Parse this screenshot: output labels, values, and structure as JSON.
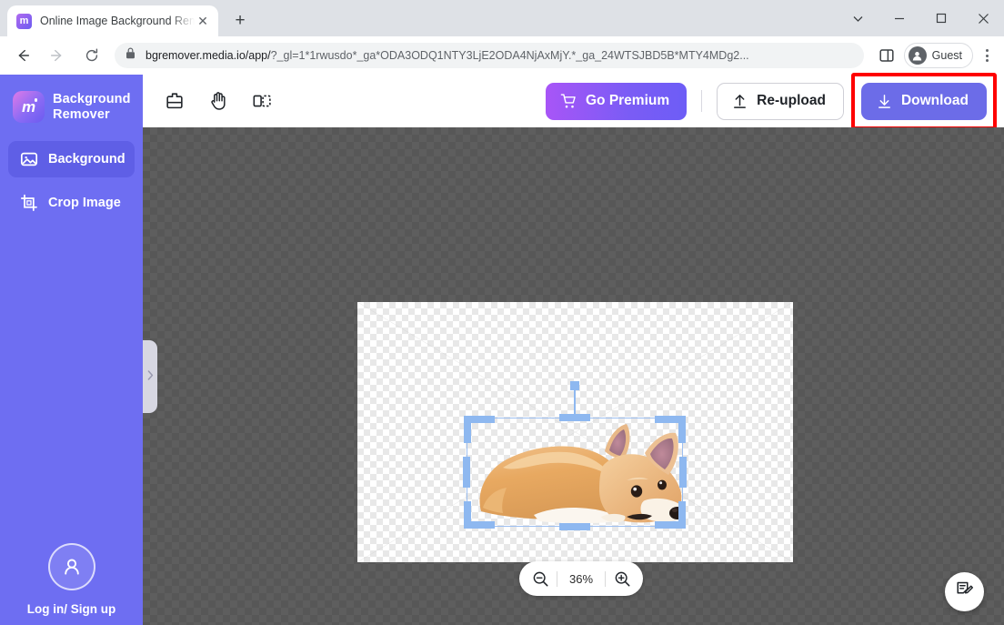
{
  "browser": {
    "tab": {
      "title": "Online Image Background Rem",
      "favicon_letter": "m",
      "favicon_name": "media-io-favicon",
      "close_label": "✕"
    },
    "new_tab_label": "+",
    "window_controls": {
      "chevron": "chevron-down",
      "minimize": "minimize",
      "maximize": "maximize",
      "close": "close"
    },
    "nav": {
      "back": "back-arrow",
      "forward": "forward-arrow",
      "reload": "reload"
    },
    "omnibox": {
      "lock": "lock-icon",
      "url_main": "bgremover.media.io/app/",
      "url_query": "?_gl=1*1rwusdo*_ga*ODA3ODQ1NTY3LjE2ODA4NjAxMjY.*_ga_24WTSJBD5B*MTY4MDg2..."
    },
    "profile": {
      "label": "Guest",
      "avatar_icon": "person-icon"
    },
    "side_panel_icon": "side-panel-icon",
    "menu_icon": "three-dot-menu"
  },
  "sidebar": {
    "brand": {
      "logo_letter": "m",
      "name_line1": "Background",
      "name_line2": "Remover"
    },
    "items": [
      {
        "label": "Background",
        "icon": "image-icon",
        "active": true
      },
      {
        "label": "Crop Image",
        "icon": "crop-icon",
        "active": false
      }
    ],
    "login": {
      "label": "Log in/ Sign up",
      "icon": "user-avatar-icon"
    }
  },
  "toolbar": {
    "tools": [
      {
        "name": "eraser-tool",
        "title": "Erase"
      },
      {
        "name": "hand-tool",
        "title": "Pan"
      },
      {
        "name": "compare-tool",
        "title": "Compare"
      }
    ],
    "premium_label": "Go Premium",
    "premium_icon": "cart-icon",
    "reupload_label": "Re-upload",
    "reupload_icon": "upload-icon",
    "download_label": "Download",
    "download_icon": "download-icon"
  },
  "canvas": {
    "panel_handle_icon": "chevron-right-icon",
    "image_subject": "corgi-dog-cutout",
    "selection_active": true
  },
  "zoom": {
    "out_icon": "zoom-out-icon",
    "in_icon": "zoom-in-icon",
    "value": "36%"
  },
  "feedback": {
    "icon": "feedback-note-icon"
  },
  "annotations": {
    "highlight_target": "Download",
    "highlight_color": "#ff0000",
    "arrow_color": "#ff0000"
  },
  "colors": {
    "sidebar_bg": "#6e6ef2",
    "sidebar_active": "#5f5fe6",
    "download_btn": "#6c6ce8",
    "premium_gradient_from": "#a855f7",
    "premium_gradient_to": "#6d5df6",
    "canvas_bg": "#575757",
    "selection_handle": "#8eb8f0"
  }
}
